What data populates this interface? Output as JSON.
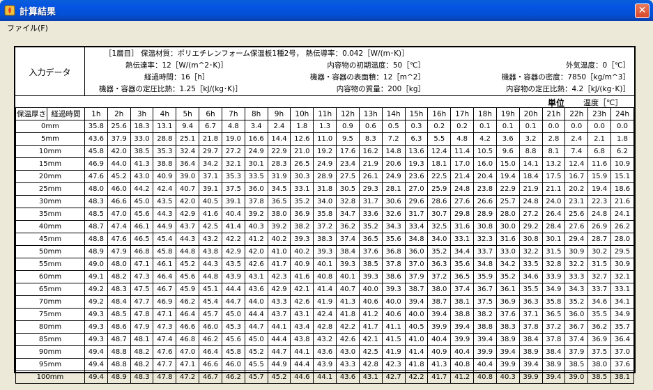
{
  "window": {
    "title": "計算結果",
    "close": "✕"
  },
  "menu": {
    "file": "ファイル(F)"
  },
  "input": {
    "label": "入力データ",
    "line1": "［1層目］ 保温材質：ポリエチレンフォーム保温板1種2号， 熱伝導率：0.042［W/(m･K)］",
    "heat_transfer": "熱伝達率：12［W/(m^2･K)］",
    "elapsed": "経過時間：16［h］",
    "specific_heat": "機器・容器の定圧比熱：1.25［kJ/(kg･K)］",
    "initial_temp": "内容物の初期温度：50［℃］",
    "surface_area": "機器・容器の表面積：12［m^2］",
    "mass": "内容物の質量：200［kg］",
    "outside_temp": "外気温度：0［℃］",
    "density": "機器・容器の密度：7850［kg/m^3］",
    "content_specific_heat": "内容物の定圧比熱：4.2［kJ/(kg･K)］"
  },
  "units": {
    "unit": "単位",
    "temp": "温度［℃］"
  },
  "table": {
    "h1": "保温厚さ",
    "h2": "経過時間",
    "hours": [
      "1h",
      "2h",
      "3h",
      "4h",
      "5h",
      "6h",
      "7h",
      "8h",
      "9h",
      "10h",
      "11h",
      "12h",
      "13h",
      "14h",
      "15h",
      "16h",
      "17h",
      "18h",
      "19h",
      "20h",
      "21h",
      "22h",
      "23h",
      "24h"
    ],
    "rows": [
      {
        "thickness": "0mm",
        "values": [
          "35.8",
          "25.6",
          "18.3",
          "13.1",
          "9.4",
          "6.7",
          "4.8",
          "3.4",
          "2.4",
          "1.8",
          "1.3",
          "0.9",
          "0.6",
          "0.5",
          "0.3",
          "0.2",
          "0.2",
          "0.1",
          "0.1",
          "0.1",
          "0.0",
          "0.0",
          "0.0",
          "0.0"
        ]
      },
      {
        "thickness": "5mm",
        "values": [
          "43.6",
          "37.9",
          "33.0",
          "28.8",
          "25.1",
          "21.8",
          "19.0",
          "16.6",
          "14.4",
          "12.6",
          "11.0",
          "9.5",
          "8.3",
          "7.2",
          "6.3",
          "5.5",
          "4.8",
          "4.2",
          "3.6",
          "3.2",
          "2.8",
          "2.4",
          "2.1",
          "1.8"
        ]
      },
      {
        "thickness": "10mm",
        "values": [
          "45.8",
          "42.0",
          "38.5",
          "35.3",
          "32.4",
          "29.7",
          "27.2",
          "24.9",
          "22.9",
          "21.0",
          "19.2",
          "17.6",
          "16.2",
          "14.8",
          "13.6",
          "12.4",
          "11.4",
          "10.5",
          "9.6",
          "8.8",
          "8.1",
          "7.4",
          "6.8",
          "6.2"
        ]
      },
      {
        "thickness": "15mm",
        "values": [
          "46.9",
          "44.0",
          "41.3",
          "38.8",
          "36.4",
          "34.2",
          "32.1",
          "30.1",
          "28.3",
          "26.5",
          "24.9",
          "23.4",
          "21.9",
          "20.6",
          "19.3",
          "18.1",
          "17.0",
          "16.0",
          "15.0",
          "14.1",
          "13.2",
          "12.4",
          "11.6",
          "10.9"
        ]
      },
      {
        "thickness": "20mm",
        "values": [
          "47.6",
          "45.2",
          "43.0",
          "40.9",
          "39.0",
          "37.1",
          "35.3",
          "33.5",
          "31.9",
          "30.3",
          "28.9",
          "27.5",
          "26.1",
          "24.9",
          "23.6",
          "22.5",
          "21.4",
          "20.4",
          "19.4",
          "18.4",
          "17.5",
          "16.7",
          "15.9",
          "15.1"
        ]
      },
      {
        "thickness": "25mm",
        "values": [
          "48.0",
          "46.0",
          "44.2",
          "42.4",
          "40.7",
          "39.1",
          "37.5",
          "36.0",
          "34.5",
          "33.1",
          "31.8",
          "30.5",
          "29.3",
          "28.1",
          "27.0",
          "25.9",
          "24.8",
          "23.8",
          "22.9",
          "21.9",
          "21.1",
          "20.2",
          "19.4",
          "18.6"
        ]
      },
      {
        "thickness": "30mm",
        "values": [
          "48.3",
          "46.6",
          "45.0",
          "43.5",
          "42.0",
          "40.5",
          "39.1",
          "37.8",
          "36.5",
          "35.2",
          "34.0",
          "32.8",
          "31.7",
          "30.6",
          "29.6",
          "28.6",
          "27.6",
          "26.6",
          "25.7",
          "24.8",
          "24.0",
          "23.1",
          "22.3",
          "21.6"
        ]
      },
      {
        "thickness": "35mm",
        "values": [
          "48.5",
          "47.0",
          "45.6",
          "44.3",
          "42.9",
          "41.6",
          "40.4",
          "39.2",
          "38.0",
          "36.9",
          "35.8",
          "34.7",
          "33.6",
          "32.6",
          "31.7",
          "30.7",
          "29.8",
          "28.9",
          "28.0",
          "27.2",
          "26.4",
          "25.6",
          "24.8",
          "24.1"
        ]
      },
      {
        "thickness": "40mm",
        "values": [
          "48.7",
          "47.4",
          "46.1",
          "44.9",
          "43.7",
          "42.5",
          "41.4",
          "40.3",
          "39.2",
          "38.2",
          "37.2",
          "36.2",
          "35.2",
          "34.3",
          "33.4",
          "32.5",
          "31.6",
          "30.8",
          "30.0",
          "29.2",
          "28.4",
          "27.6",
          "26.9",
          "26.2"
        ]
      },
      {
        "thickness": "45mm",
        "values": [
          "48.8",
          "47.6",
          "46.5",
          "45.4",
          "44.3",
          "43.2",
          "42.2",
          "41.2",
          "40.2",
          "39.3",
          "38.3",
          "37.4",
          "36.5",
          "35.6",
          "34.8",
          "34.0",
          "33.1",
          "32.3",
          "31.6",
          "30.8",
          "30.1",
          "29.4",
          "28.7",
          "28.0"
        ]
      },
      {
        "thickness": "50mm",
        "values": [
          "48.9",
          "47.9",
          "46.8",
          "45.8",
          "44.8",
          "43.8",
          "42.9",
          "42.0",
          "41.0",
          "40.2",
          "39.3",
          "38.4",
          "37.6",
          "36.8",
          "36.0",
          "35.2",
          "34.4",
          "33.7",
          "33.0",
          "32.2",
          "31.5",
          "30.9",
          "30.2",
          "29.5"
        ]
      },
      {
        "thickness": "55mm",
        "values": [
          "49.0",
          "48.0",
          "47.1",
          "46.1",
          "45.2",
          "44.3",
          "43.5",
          "42.6",
          "41.7",
          "40.9",
          "40.1",
          "39.3",
          "38.5",
          "37.8",
          "37.0",
          "36.3",
          "35.6",
          "34.8",
          "34.2",
          "33.5",
          "32.8",
          "32.2",
          "31.5",
          "30.9"
        ]
      },
      {
        "thickness": "60mm",
        "values": [
          "49.1",
          "48.2",
          "47.3",
          "46.4",
          "45.6",
          "44.8",
          "43.9",
          "43.1",
          "42.3",
          "41.6",
          "40.8",
          "40.1",
          "39.3",
          "38.6",
          "37.9",
          "37.2",
          "36.5",
          "35.9",
          "35.2",
          "34.6",
          "33.9",
          "33.3",
          "32.7",
          "32.1"
        ]
      },
      {
        "thickness": "65mm",
        "values": [
          "49.2",
          "48.3",
          "47.5",
          "46.7",
          "45.9",
          "45.1",
          "44.4",
          "43.6",
          "42.9",
          "42.1",
          "41.4",
          "40.7",
          "40.0",
          "39.3",
          "38.7",
          "38.0",
          "37.4",
          "36.7",
          "36.1",
          "35.5",
          "34.9",
          "34.3",
          "33.7",
          "33.1"
        ]
      },
      {
        "thickness": "70mm",
        "values": [
          "49.2",
          "48.4",
          "47.7",
          "46.9",
          "46.2",
          "45.4",
          "44.7",
          "44.0",
          "43.3",
          "42.6",
          "41.9",
          "41.3",
          "40.6",
          "40.0",
          "39.4",
          "38.7",
          "38.1",
          "37.5",
          "36.9",
          "36.3",
          "35.8",
          "35.2",
          "34.6",
          "34.1"
        ]
      },
      {
        "thickness": "75mm",
        "values": [
          "49.3",
          "48.5",
          "47.8",
          "47.1",
          "46.4",
          "45.7",
          "45.0",
          "44.4",
          "43.7",
          "43.1",
          "42.4",
          "41.8",
          "41.2",
          "40.6",
          "40.0",
          "39.4",
          "38.8",
          "38.2",
          "37.6",
          "37.1",
          "36.5",
          "36.0",
          "35.5",
          "34.9"
        ]
      },
      {
        "thickness": "80mm",
        "values": [
          "49.3",
          "48.6",
          "47.9",
          "47.3",
          "46.6",
          "46.0",
          "45.3",
          "44.7",
          "44.1",
          "43.4",
          "42.8",
          "42.2",
          "41.7",
          "41.1",
          "40.5",
          "39.9",
          "39.4",
          "38.8",
          "38.3",
          "37.8",
          "37.2",
          "36.7",
          "36.2",
          "35.7"
        ]
      },
      {
        "thickness": "85mm",
        "values": [
          "49.3",
          "48.7",
          "48.1",
          "47.4",
          "46.8",
          "46.2",
          "45.6",
          "45.0",
          "44.4",
          "43.8",
          "43.2",
          "42.6",
          "42.1",
          "41.5",
          "41.0",
          "40.4",
          "39.9",
          "39.4",
          "38.9",
          "38.4",
          "37.8",
          "37.4",
          "36.9",
          "36.4"
        ]
      },
      {
        "thickness": "90mm",
        "values": [
          "49.4",
          "48.8",
          "48.2",
          "47.6",
          "47.0",
          "46.4",
          "45.8",
          "45.2",
          "44.7",
          "44.1",
          "43.6",
          "43.0",
          "42.5",
          "41.9",
          "41.4",
          "40.9",
          "40.4",
          "39.9",
          "39.4",
          "38.9",
          "38.4",
          "37.9",
          "37.5",
          "37.0"
        ]
      },
      {
        "thickness": "95mm",
        "values": [
          "49.4",
          "48.8",
          "48.2",
          "47.7",
          "47.1",
          "46.6",
          "46.0",
          "45.5",
          "44.9",
          "44.4",
          "43.9",
          "43.3",
          "42.8",
          "42.3",
          "41.8",
          "41.3",
          "40.8",
          "40.4",
          "39.9",
          "39.4",
          "38.9",
          "38.5",
          "38.0",
          "37.6"
        ]
      },
      {
        "thickness": "100mm",
        "values": [
          "49.4",
          "48.9",
          "48.3",
          "47.8",
          "47.2",
          "46.7",
          "46.2",
          "45.7",
          "45.2",
          "44.6",
          "44.1",
          "43.6",
          "43.1",
          "42.7",
          "42.2",
          "41.7",
          "41.2",
          "40.8",
          "40.3",
          "39.9",
          "39.4",
          "39.0",
          "38.5",
          "38.1"
        ]
      }
    ]
  }
}
